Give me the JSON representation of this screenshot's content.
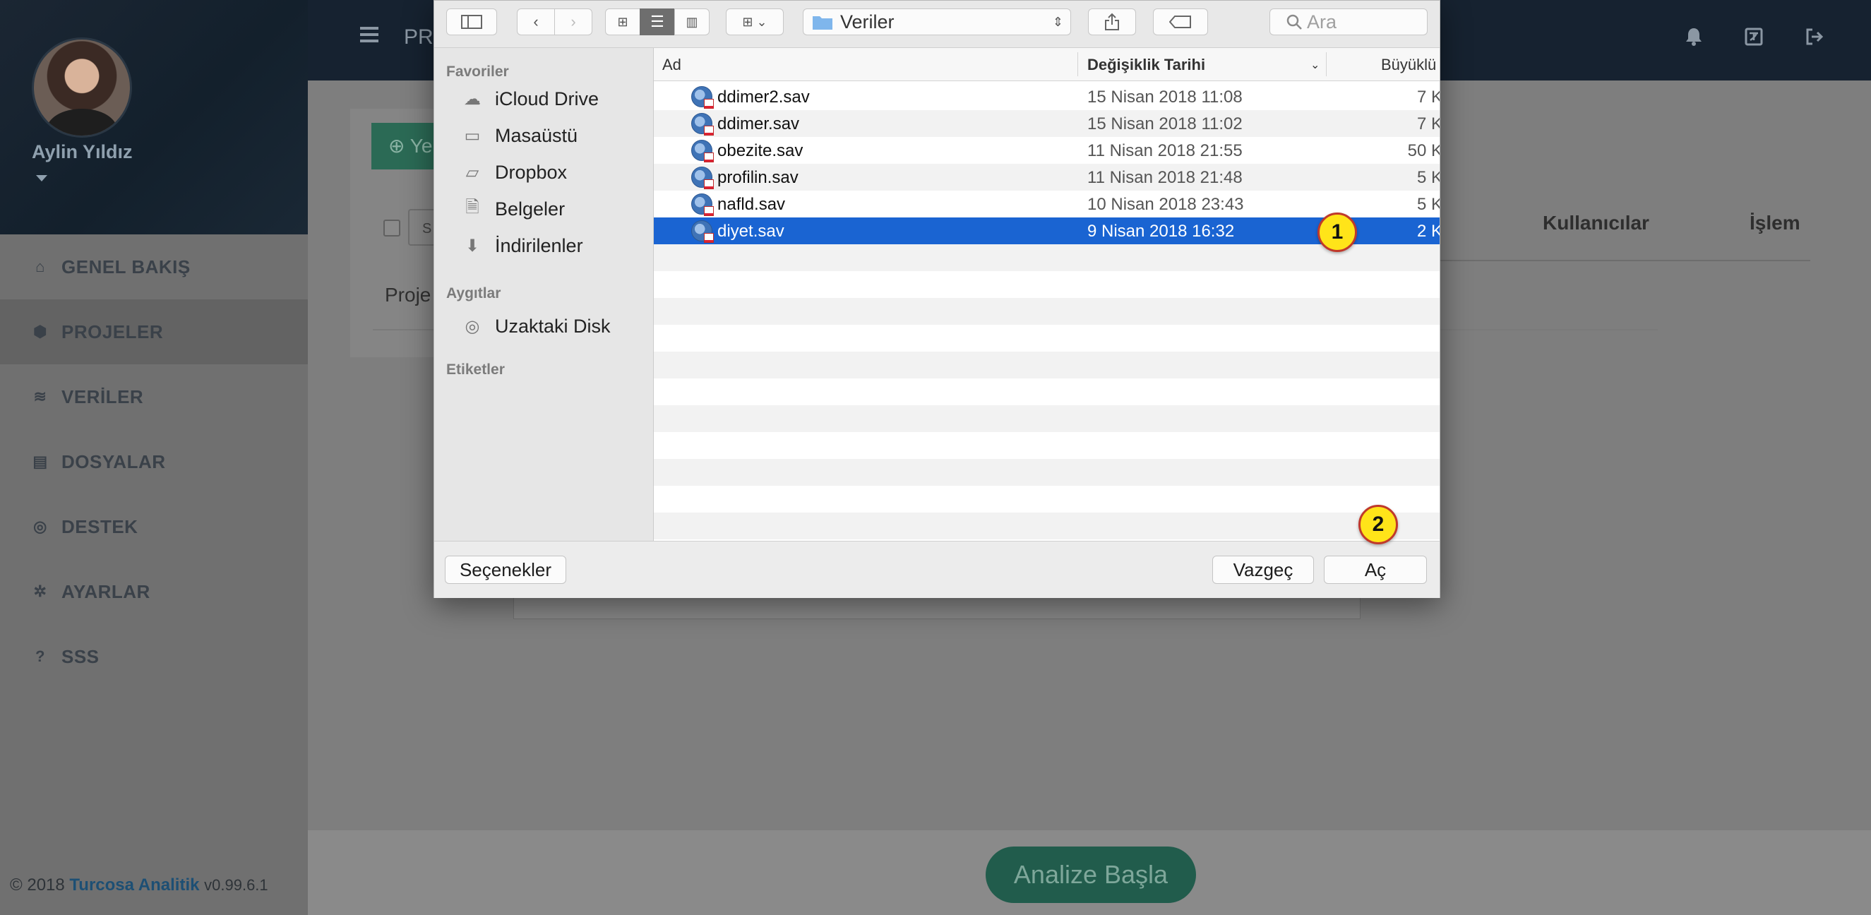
{
  "app": {
    "title": "PR",
    "new_button_label": "Ye",
    "select_label": "S",
    "table": {
      "col_users": "Kullanıcılar",
      "col_action": "İşlem",
      "row_project": "Proje"
    },
    "start_button": "Analize Başla"
  },
  "sidebar": {
    "user_name": "Aylin Yıldız",
    "items": [
      {
        "label": "GENEL BAKIŞ",
        "icon": "home-icon"
      },
      {
        "label": "PROJELER",
        "icon": "cube-icon"
      },
      {
        "label": "VERİLER",
        "icon": "database-icon"
      },
      {
        "label": "DOSYALAR",
        "icon": "file-icon"
      },
      {
        "label": "DESTEK",
        "icon": "lifebuoy-icon"
      },
      {
        "label": "AYARLAR",
        "icon": "gear-icon"
      },
      {
        "label": "SSS",
        "icon": "question-circle-icon"
      }
    ],
    "active_index": 1,
    "footer": {
      "copyright": "© 2018",
      "brand": "Turcosa Analitik",
      "version": "v0.99.6.1"
    }
  },
  "topbar_icons": [
    "bell-icon",
    "language-icon",
    "logout-icon"
  ],
  "dialog": {
    "location": "Veriler",
    "search_placeholder": "Ara",
    "sidebar": {
      "favorites_header": "Favoriler",
      "favorites": [
        {
          "label": "iCloud Drive",
          "icon": "cloud-icon"
        },
        {
          "label": "Masaüstü",
          "icon": "desktop-icon"
        },
        {
          "label": "Dropbox",
          "icon": "folder-icon"
        },
        {
          "label": "Belgeler",
          "icon": "document-icon"
        },
        {
          "label": "İndirilenler",
          "icon": "download-icon"
        }
      ],
      "devices_header": "Aygıtlar",
      "devices": [
        {
          "label": "Uzaktaki Disk",
          "icon": "disc-icon"
        }
      ],
      "tags_header": "Etiketler"
    },
    "columns": {
      "name": "Ad",
      "date": "Değişiklik Tarihi",
      "size": "Büyüklü"
    },
    "files": [
      {
        "name": "ddimer2.sav",
        "date": "15 Nisan 2018 11:08",
        "size": "7 K"
      },
      {
        "name": "ddimer.sav",
        "date": "15 Nisan 2018 11:02",
        "size": "7 K"
      },
      {
        "name": "obezite.sav",
        "date": "11 Nisan 2018 21:55",
        "size": "50 K"
      },
      {
        "name": "profilin.sav",
        "date": "11 Nisan 2018 21:48",
        "size": "5 K"
      },
      {
        "name": "nafld.sav",
        "date": "10 Nisan 2018 23:43",
        "size": "5 K"
      },
      {
        "name": "diyet.sav",
        "date": "9 Nisan 2018 16:32",
        "size": "2 K"
      }
    ],
    "selected_file_index": 5,
    "options_button": "Seçenekler",
    "cancel_button": "Vazgeç",
    "open_button": "Aç",
    "callouts": [
      "1",
      "2"
    ]
  }
}
